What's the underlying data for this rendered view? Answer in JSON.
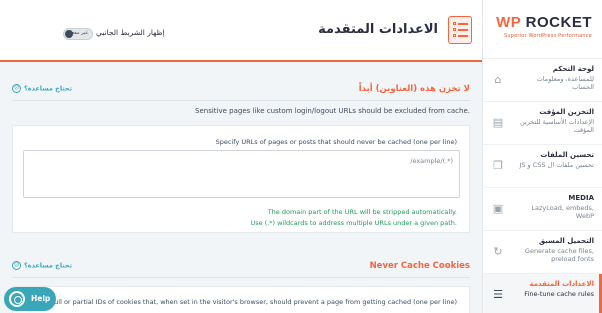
{
  "brand": {
    "logo_wp": "WP",
    "logo_rocket": "ROCKET",
    "tagline": "Superior WordPress Performance"
  },
  "sidebar": {
    "items": [
      {
        "title": "لوحة التحكم",
        "desc": "للمساعدة، ومعلومات الحساب",
        "icon": "home-icon"
      },
      {
        "title": "التخزين المؤقت",
        "desc": "الإعدادات الأساسية للتخزين المؤقت",
        "icon": "cache-icon"
      },
      {
        "title": "تحسين الملفات",
        "desc": "تحسين ملفات ال CSS و JS",
        "icon": "files-icon"
      },
      {
        "title": "MEDIA",
        "desc": "LazyLoad, embeds, WebP",
        "icon": "media-icon"
      },
      {
        "title": "التحميل المسبق",
        "desc": "Generate cache files, preload fonts",
        "icon": "refresh-icon"
      },
      {
        "title": "الاعدادات المتقدمة",
        "desc": "Fine-tune cache rules",
        "icon": "list-icon",
        "active": true
      }
    ]
  },
  "header": {
    "title": "الاعدادات المتقدمة",
    "toggle_label": "إظهار الشريط الجانبي",
    "toggle_state": "غير مفعل"
  },
  "section1": {
    "title": "لا تخزن هذه (العناوين) أبداً",
    "help": "تحتاج مساعدة؟",
    "description": "Sensitive pages like custom login/logout URLs should be excluded from cache.",
    "field_label": "Specify URLs of pages or posts that should never be cached (one per line)",
    "placeholder": "/example/(.*)",
    "hint1": "The domain part of the URL will be stripped automatically.",
    "hint2": "Use (.*) wildcards to address multiple URLs under a given path."
  },
  "section2": {
    "title": "Never Cache Cookies",
    "help": "تحتاج مساعدة؟",
    "field_label": "Specify full or partial IDs of cookies that, when set in the visitor's browser, should prevent a page from getting cached (one per line)"
  },
  "help_bubble": {
    "label": "Help"
  },
  "colors": {
    "accent": "#f56640",
    "help": "#3aa6b9",
    "hint": "#1f9b5b"
  }
}
